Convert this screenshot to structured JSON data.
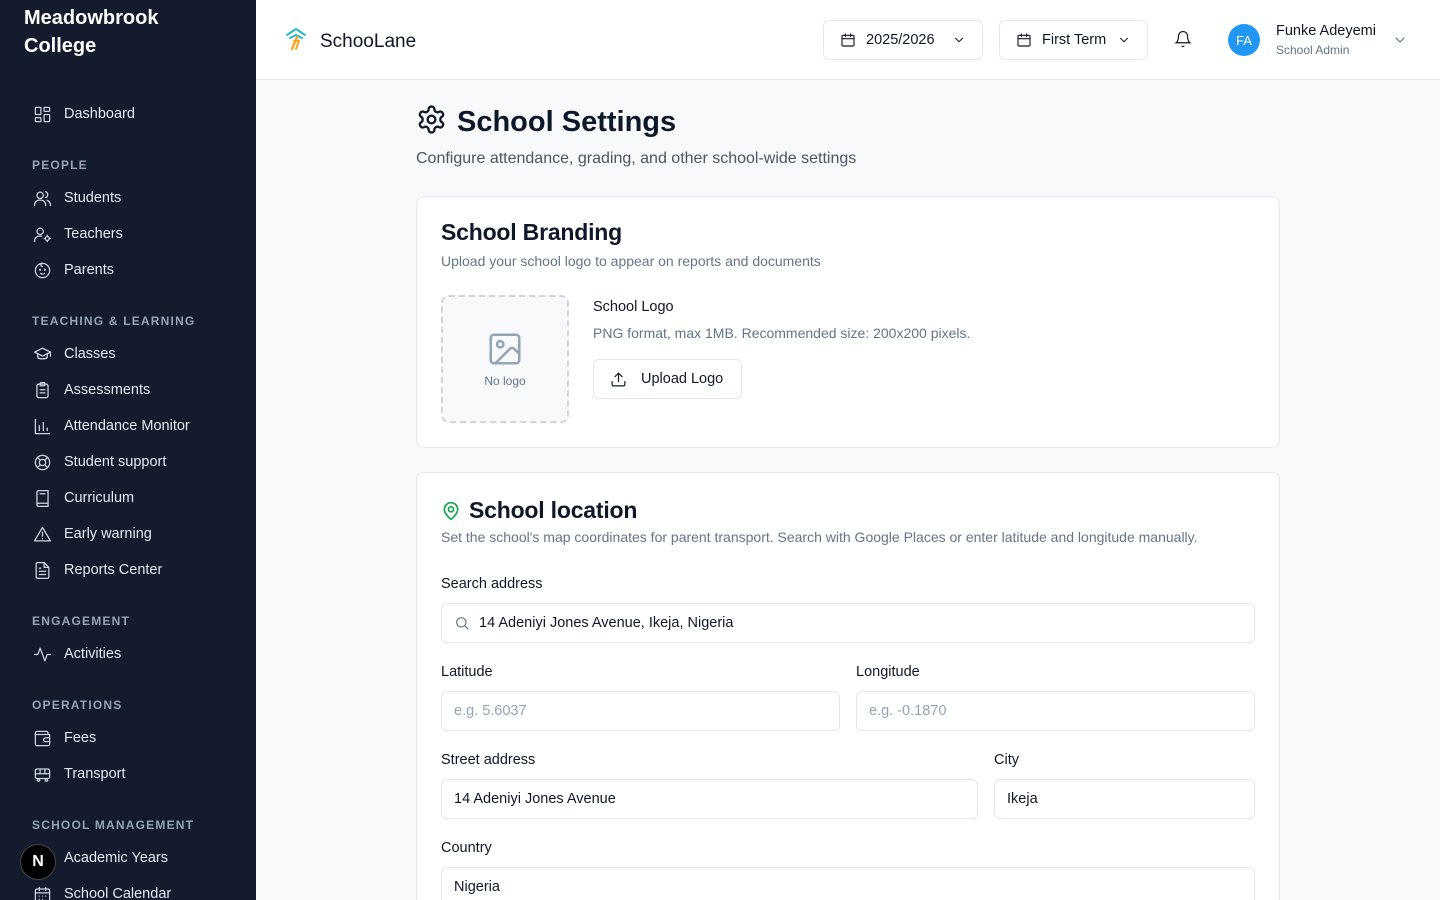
{
  "sidebar": {
    "school_name": "Meadowbrook College",
    "items": {
      "dashboard": "Dashboard",
      "students": "Students",
      "teachers": "Teachers",
      "parents": "Parents",
      "classes": "Classes",
      "assessments": "Assessments",
      "attendance": "Attendance Monitor",
      "support": "Student support",
      "curriculum": "Curriculum",
      "warning": "Early warning",
      "reports": "Reports Center",
      "activities": "Activities",
      "fees": "Fees",
      "transport": "Transport",
      "academic_years": "Academic Years",
      "calendar": "School Calendar"
    },
    "sections": {
      "people": "PEOPLE",
      "teaching": "TEACHING & LEARNING",
      "engagement": "ENGAGEMENT",
      "operations": "OPERATIONS",
      "management": "SCHOOL MANAGEMENT"
    },
    "badge": "N"
  },
  "header": {
    "brand": "SchooLane",
    "year": "2025/2026",
    "term": "First Term",
    "user": {
      "initials": "FA",
      "name": "Funke Adeyemi",
      "role": "School Admin"
    }
  },
  "page": {
    "title": "School Settings",
    "subtitle": "Configure attendance, grading, and other school-wide settings"
  },
  "branding": {
    "title": "School Branding",
    "desc": "Upload your school logo to appear on reports and documents",
    "no_logo": "No logo",
    "logo_label": "School Logo",
    "logo_hint": "PNG format, max 1MB. Recommended size: 200x200 pixels.",
    "upload": "Upload Logo"
  },
  "location": {
    "title": "School location",
    "desc": "Set the school's map coordinates for parent transport. Search with Google Places or enter latitude and longitude manually.",
    "search_label": "Search address",
    "search_value": "14 Adeniyi Jones Avenue, Ikeja, Nigeria",
    "lat_label": "Latitude",
    "lat_placeholder": "e.g. 5.6037",
    "lng_label": "Longitude",
    "lng_placeholder": "e.g. -0.1870",
    "street_label": "Street address",
    "street_value": "14 Adeniyi Jones Avenue",
    "city_label": "City",
    "city_value": "Ikeja",
    "country_label": "Country",
    "country_value": "Nigeria"
  },
  "colors": {
    "sidebar_bg": "#141b2d",
    "avatar": "#2196f3",
    "location_icon": "#16a34a"
  }
}
